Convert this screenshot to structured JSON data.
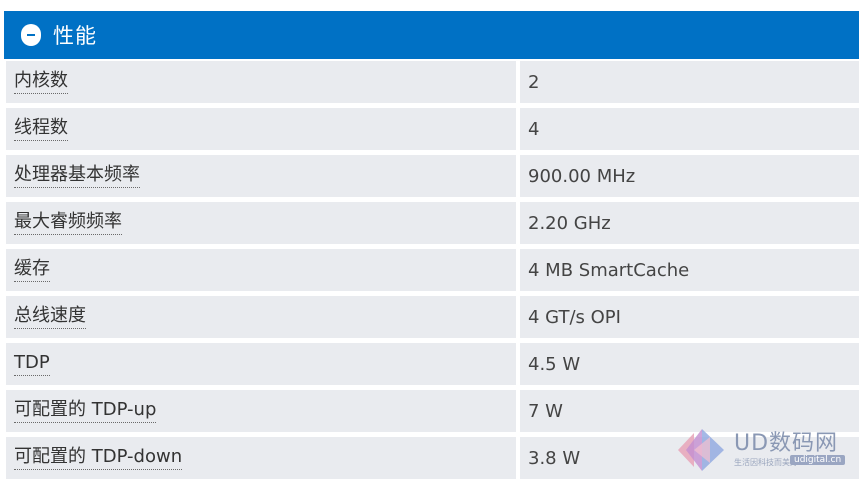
{
  "section": {
    "title": "性能"
  },
  "specs": [
    {
      "label": "内核数",
      "value": "2"
    },
    {
      "label": "线程数",
      "value": "4"
    },
    {
      "label": "处理器基本频率",
      "value": "900.00 MHz"
    },
    {
      "label": "最大睿频频率",
      "value": "2.20 GHz"
    },
    {
      "label": "缓存",
      "value": "4 MB SmartCache"
    },
    {
      "label": "总线速度",
      "value": "4 GT/s OPI"
    },
    {
      "label": "TDP",
      "value": "4.5 W"
    },
    {
      "label": "可配置的 TDP-up",
      "value": "7 W"
    },
    {
      "label": "可配置的 TDP-down",
      "value": "3.8 W"
    }
  ],
  "watermark": {
    "name": "UD数码网",
    "tagline": "生活因科技而美好",
    "domain": "udigital.cn"
  },
  "colors": {
    "header": "#0071c5",
    "row": "#e9ebef"
  }
}
